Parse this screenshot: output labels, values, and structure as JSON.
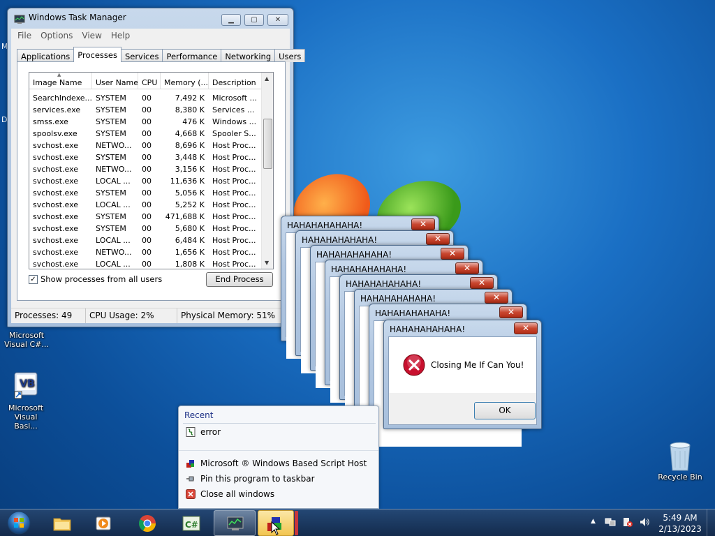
{
  "colors": {
    "desktop": "#1a6fc4",
    "titlebar": "#b3c8e2",
    "close_button": "#c8462f",
    "error_icon": "#c8102e",
    "taskbar": "#1e3a5f",
    "active_task": "#f2c550"
  },
  "desktop_icons": [
    {
      "label": "Microsoft Visual C#...",
      "icon": "csharp-icon"
    },
    {
      "label": "Microsoft Visual Basi...",
      "icon": "visual-basic-icon"
    },
    {
      "label": "Recycle Bin",
      "icon": "recycle-bin-icon"
    }
  ],
  "task_manager": {
    "title": "Windows Task Manager",
    "menu": [
      "File",
      "Options",
      "View",
      "Help"
    ],
    "tabs": [
      "Applications",
      "Processes",
      "Services",
      "Performance",
      "Networking",
      "Users"
    ],
    "active_tab": "Processes",
    "columns": [
      "Image Name",
      "User Name",
      "CPU",
      "Memory (...",
      "Description"
    ],
    "rows": [
      [
        "SearchIndexe...",
        "SYSTEM",
        "00",
        "7,492 K",
        "Microsoft ..."
      ],
      [
        "services.exe",
        "SYSTEM",
        "00",
        "8,380 K",
        "Services ..."
      ],
      [
        "smss.exe",
        "SYSTEM",
        "00",
        "476 K",
        "Windows ..."
      ],
      [
        "spoolsv.exe",
        "SYSTEM",
        "00",
        "4,668 K",
        "Spooler S..."
      ],
      [
        "svchost.exe",
        "NETWO...",
        "00",
        "8,696 K",
        "Host Proc..."
      ],
      [
        "svchost.exe",
        "SYSTEM",
        "00",
        "3,448 K",
        "Host Proc..."
      ],
      [
        "svchost.exe",
        "NETWO...",
        "00",
        "3,156 K",
        "Host Proc..."
      ],
      [
        "svchost.exe",
        "LOCAL ...",
        "00",
        "11,636 K",
        "Host Proc..."
      ],
      [
        "svchost.exe",
        "SYSTEM",
        "00",
        "5,056 K",
        "Host Proc..."
      ],
      [
        "svchost.exe",
        "LOCAL ...",
        "00",
        "5,252 K",
        "Host Proc..."
      ],
      [
        "svchost.exe",
        "SYSTEM",
        "00",
        "471,688 K",
        "Host Proc..."
      ],
      [
        "svchost.exe",
        "SYSTEM",
        "00",
        "5,680 K",
        "Host Proc..."
      ],
      [
        "svchost.exe",
        "LOCAL ...",
        "00",
        "6,484 K",
        "Host Proc..."
      ],
      [
        "svchost.exe",
        "NETWO...",
        "00",
        "1,656 K",
        "Host Proc..."
      ],
      [
        "svchost.exe",
        "LOCAL ...",
        "00",
        "1,808 K",
        "Host Proc..."
      ]
    ],
    "show_all_users_label": "Show processes from all users",
    "show_all_users_checked": true,
    "end_process_label": "End Process",
    "status": {
      "processes": "Processes: 49",
      "cpu": "CPU Usage: 2%",
      "memory": "Physical Memory: 51%"
    }
  },
  "popups": {
    "title": "HAHAHAHAHAHA!",
    "count": 8,
    "message": "Closing Me If Can You!",
    "ok_label": "OK"
  },
  "jump_list": {
    "recent_header": "Recent",
    "recent_items": [
      {
        "label": "error",
        "icon": "script-file-icon"
      }
    ],
    "tasks": [
      {
        "label": "Microsoft ® Windows Based Script Host",
        "icon": "script-host-icon"
      },
      {
        "label": "Pin this program to taskbar",
        "icon": "pin-icon"
      },
      {
        "label": "Close all windows",
        "icon": "close-windows-icon"
      }
    ]
  },
  "taskbar": {
    "apps": [
      {
        "name": "file-explorer",
        "icon": "folder-icon"
      },
      {
        "name": "media-player",
        "icon": "media-player-icon"
      },
      {
        "name": "chrome",
        "icon": "chrome-icon"
      },
      {
        "name": "csharp",
        "icon": "csharp-icon"
      },
      {
        "name": "task-manager",
        "icon": "task-manager-icon"
      },
      {
        "name": "script-host",
        "icon": "script-host-icon"
      }
    ],
    "clock_time": "5:49 AM",
    "clock_date": "2/13/2023"
  }
}
